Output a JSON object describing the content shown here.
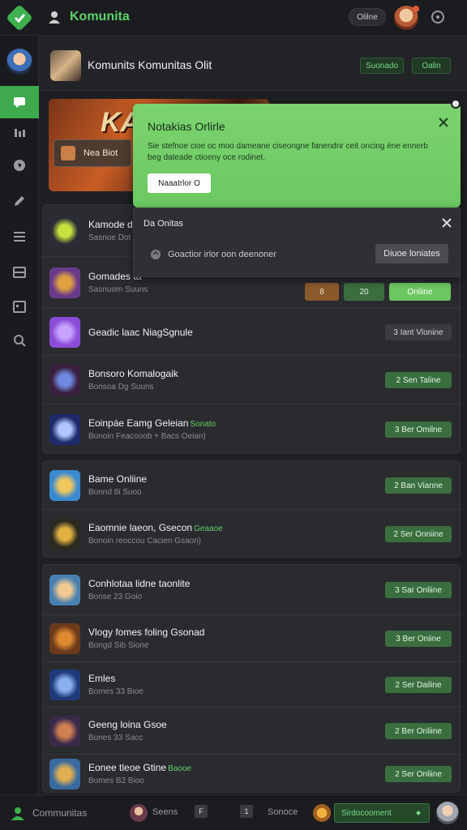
{
  "app": {
    "title": "Komunita",
    "status_pill": "Olilne"
  },
  "header": {
    "title": "Komunits Komunitas Olit",
    "chip1": "Suonado",
    "chip2": "Oalin"
  },
  "banner": {
    "logo_text": "KAI",
    "button_label": "Nea Biot"
  },
  "notification": {
    "title": "Notakias Orlirle",
    "body": "Sie stefnoe cioe oc moo dameane ciseongne fanendnr ceit oncing éne ennerb beg dateade ctioeny oce rodinet.",
    "button_label": "Naaatrlor O"
  },
  "popup": {
    "title": "Da Onitas",
    "text": "Goactior irlor oon deenoner",
    "button_label": "Diuoe loniates"
  },
  "row2_buttons": {
    "orange": "8",
    "green": "20",
    "online": "Onliine"
  },
  "groups": [
    {
      "rows": [
        {
          "title": "Kamode dit",
          "sub": "Sasnoe Dot",
          "button": "",
          "icon_color": "#2a2d35",
          "icon_accent": "#c8e040"
        },
        {
          "title": "Gomades ta",
          "sub": "Sasnuom Suuns",
          "button": "",
          "icon_color": "#6a3a8a",
          "icon_accent": "#e0a040"
        },
        {
          "title": "Geadic laac NiagSgnule",
          "sub": "",
          "button": "3 Iant Vlonine",
          "btn_style": "dark",
          "icon_color": "#8a4bd6",
          "icon_accent": "#c7a3ff"
        },
        {
          "title": "Bonsoro Komalogaik",
          "sub": "Bonsoa Dg Suuns",
          "button": "2 Sen Taline",
          "btn_style": "green",
          "icon_color": "#3a1f3f",
          "icon_accent": "#6f8ae0"
        },
        {
          "title": "Eoinpáe Eamg Geleian",
          "tag": "Sonato",
          "sub": "Bonoin Feacooob + Bacs Oeian)",
          "button": "3 Ber Omilne",
          "btn_style": "green",
          "icon_color": "#1f2a6a",
          "icon_accent": "#b0c8ff"
        }
      ]
    },
    {
      "rows": [
        {
          "title": "Bame Onliine",
          "sub": "Bonnd 8i Suoo",
          "button": "2 Ban Vianne",
          "btn_style": "green",
          "icon_color": "#3a8ad0",
          "icon_accent": "#f0c860"
        },
        {
          "title": "Eaomnie laeon, Gsecon",
          "tag": "Geaaoe",
          "sub": "Bonoin reoccou Cacien Gsaon)",
          "button": "2 Ser Onniine",
          "btn_style": "green",
          "icon_color": "#2a2a20",
          "icon_accent": "#e0b040"
        }
      ]
    },
    {
      "rows": [
        {
          "title": "Conhlotaa lidne taonlite",
          "sub": "Bonse 23 Goio",
          "button": "3 Sar Onliine",
          "btn_style": "green",
          "icon_color": "#4a80b0",
          "icon_accent": "#f0c890"
        },
        {
          "title": "Vlogy fomes foling Gsonad",
          "sub": "Bongd Sib Sione",
          "button": "3 Ber Oniine",
          "btn_style": "green",
          "icon_color": "#6a3a1a",
          "icon_accent": "#e08a30"
        },
        {
          "title": "Emles",
          "sub": "Bomes 33 Bioe",
          "button": "2 Ser Dailine",
          "btn_style": "green",
          "icon_color": "#1f3a7a",
          "icon_accent": "#8ab0f0"
        },
        {
          "title": "Geeng loina Gsoe",
          "sub": "Bones 33 Sacc",
          "button": "2 Ber Onliine",
          "btn_style": "green",
          "icon_color": "#3a2a4a",
          "icon_accent": "#d08050"
        },
        {
          "title": "Eonee tleoe Gtine",
          "tag": "Baooe",
          "sub": "Bomes B2 Bioo",
          "button": "2 Ser Onliine",
          "btn_style": "green",
          "icon_color": "#3a6aa0",
          "icon_accent": "#e0b050"
        }
      ]
    }
  ],
  "bottom": {
    "label": "Communitas",
    "text1": "Seens",
    "sq1": "F",
    "sq2": "1",
    "text2": "Sonoce",
    "pill": "Sirdocooment"
  },
  "colors": {
    "accent_green": "#5ed16a",
    "button_green": "#3b6e3f",
    "notification_bg": "#7bd36f",
    "background": "#1e1f22"
  }
}
